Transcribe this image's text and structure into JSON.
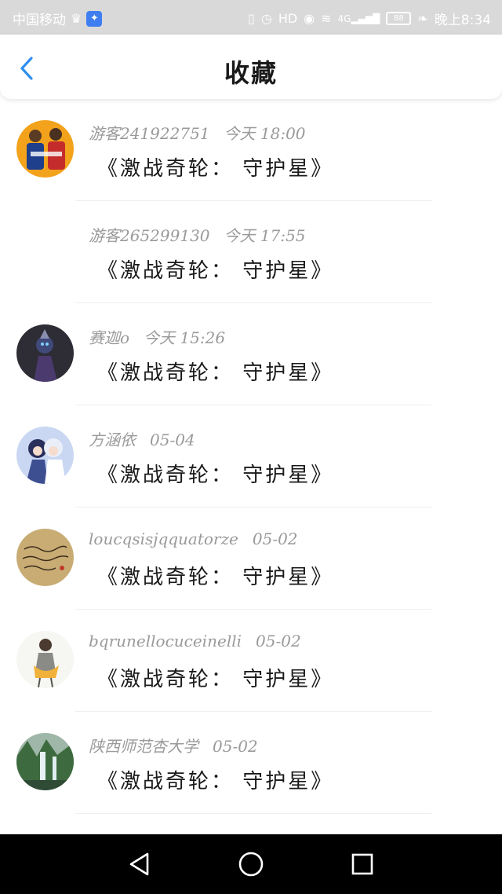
{
  "status_bar": {
    "carrier": "中国移动",
    "time": "晚上8:34",
    "battery": "88",
    "network": "4G"
  },
  "header": {
    "title": "收藏"
  },
  "items": [
    {
      "user": "游客241922751",
      "time": "今天 18:00",
      "content": "《激战奇轮： 守护星》",
      "avatar": "orange-team-avatar"
    },
    {
      "user": "游客265299130",
      "time": "今天 17:55",
      "content": "《激战奇轮： 守护星》",
      "avatar": "none"
    },
    {
      "user": "赛迦o",
      "time": "今天 15:26",
      "content": "《激战奇轮： 守护星》",
      "avatar": "hero-dark-avatar"
    },
    {
      "user": "方涵依",
      "time": "05-04",
      "content": "《激战奇轮： 守护星》",
      "avatar": "anime-couple-avatar"
    },
    {
      "user": "loucqsisjqquatorze",
      "time": "05-02",
      "content": "《激战奇轮： 守护星》",
      "avatar": "handwriting-avatar"
    },
    {
      "user": "bqrunellocuceinelli",
      "time": "05-02",
      "content": "《激战奇轮： 守护星》",
      "avatar": "sketch-girl-avatar"
    },
    {
      "user": "陕西师范杏大学",
      "time": "05-02",
      "content": "《激战奇轮： 守护星》",
      "avatar": "waterfall-avatar"
    }
  ],
  "nav_bar": {
    "buttons": [
      "back-triangle-icon",
      "home-circle-icon",
      "recent-square-icon"
    ]
  },
  "colors": {
    "status_bar_bg": "#d9d9d9",
    "accent": "#2f8ff0",
    "meta_text": "#9a9a9a",
    "nav_bar_bg": "#000000"
  }
}
